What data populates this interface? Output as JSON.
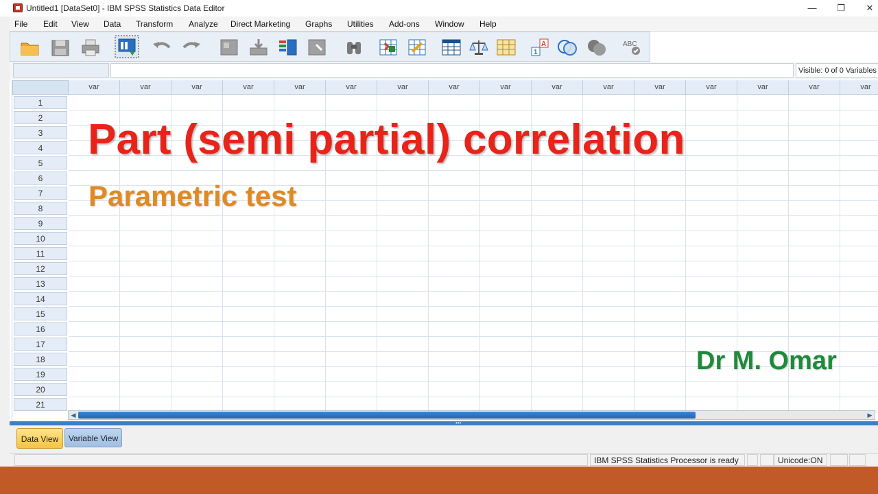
{
  "window": {
    "title": "Untitled1 [DataSet0] - IBM SPSS Statistics Data Editor",
    "controls": {
      "minimize": "—",
      "restore": "❐",
      "close": "✕"
    }
  },
  "menu": {
    "items": [
      "File",
      "Edit",
      "View",
      "Data",
      "Transform",
      "Analyze",
      "Direct Marketing",
      "Graphs",
      "Utilities",
      "Add-ons",
      "Window",
      "Help"
    ]
  },
  "toolbar": {
    "icons": [
      "open-folder-icon",
      "save-icon",
      "print-icon",
      "dialog-recall-icon",
      "undo-icon",
      "redo-icon",
      "go-to-case-icon",
      "go-to-variable-icon",
      "variables-icon",
      "find-icon",
      "insert-cases-icon",
      "insert-variable-icon",
      "split-file-icon",
      "weight-cases-icon",
      "select-cases-icon",
      "value-labels-icon",
      "use-sets-icon",
      "show-all-variables-icon",
      "spell-check-icon"
    ]
  },
  "cellbar": {
    "cell_reference": "",
    "cell_value": "",
    "visible_count": "Visible: 0 of 0 Variables"
  },
  "grid": {
    "column_headers": [
      "var",
      "var",
      "var",
      "var",
      "var",
      "var",
      "var",
      "var",
      "var",
      "var",
      "var",
      "var",
      "var",
      "var",
      "var",
      "var"
    ],
    "row_numbers": [
      "1",
      "2",
      "3",
      "4",
      "5",
      "6",
      "7",
      "8",
      "9",
      "10",
      "11",
      "12",
      "13",
      "14",
      "15",
      "16",
      "17",
      "18",
      "19",
      "20",
      "21"
    ]
  },
  "tabs": {
    "data_view": "Data View",
    "variable_view": "Variable View",
    "active": "Data View"
  },
  "status": {
    "processor": "IBM SPSS Statistics Processor is ready",
    "unicode": "Unicode:ON"
  },
  "overlay": {
    "title": "Part (semi partial) correlation",
    "subtitle": "Parametric test",
    "author": "Dr M. Omar"
  },
  "colors": {
    "title": "#e8231a",
    "subtitle": "#e08a22",
    "author": "#1f8a3b",
    "bottom_band": "#c25a28",
    "accent_blue": "#3b7fc4"
  }
}
